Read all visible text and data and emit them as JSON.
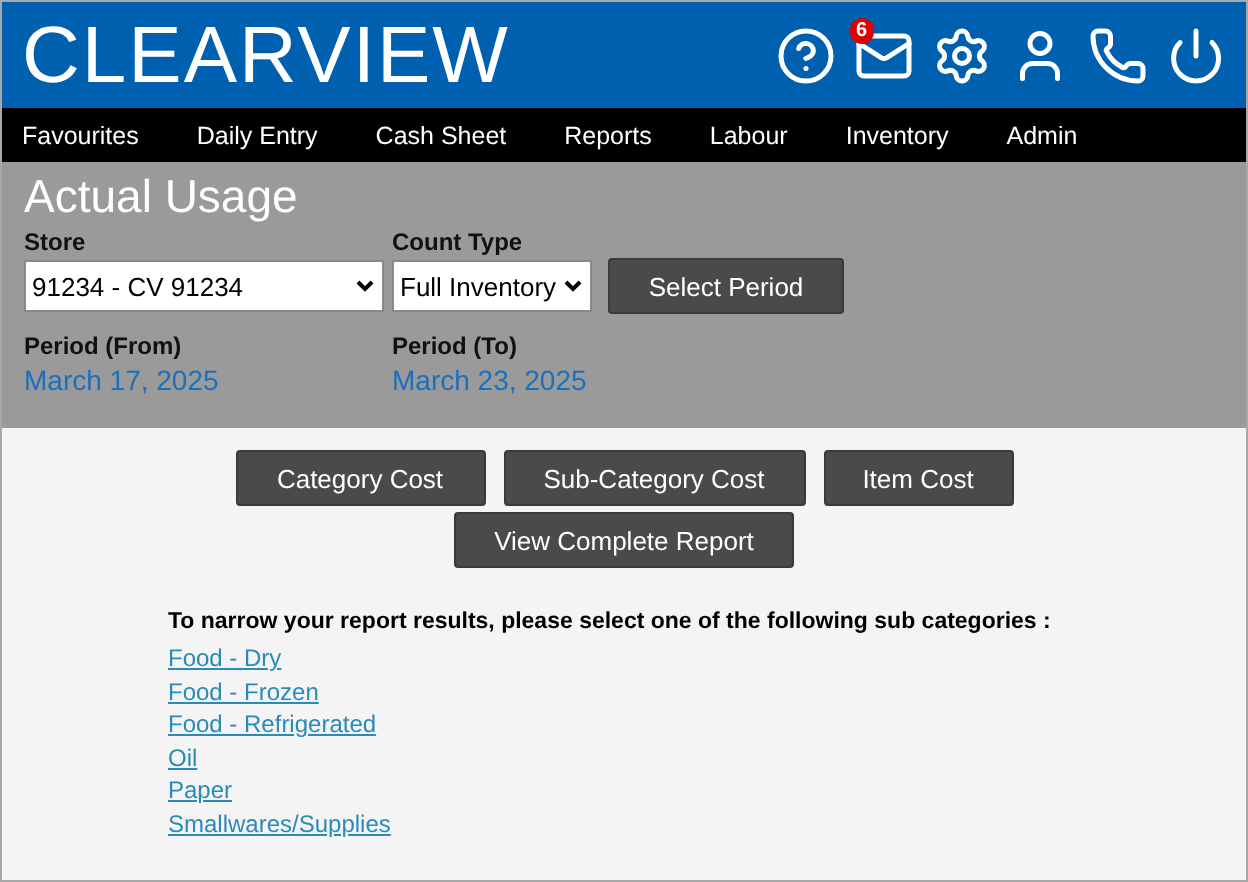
{
  "logo": "CLEARVIEW",
  "header_icons": [
    {
      "kind": "help"
    },
    {
      "kind": "mail",
      "badge": "6"
    },
    {
      "kind": "settings"
    },
    {
      "kind": "user"
    },
    {
      "kind": "phone"
    },
    {
      "kind": "power"
    }
  ],
  "nav": [
    "Favourites",
    "Daily Entry",
    "Cash Sheet",
    "Reports",
    "Labour",
    "Inventory",
    "Admin"
  ],
  "page_title": "Actual Usage",
  "store": {
    "label": "Store",
    "value": "91234 - CV 91234"
  },
  "count_type": {
    "label": "Count Type",
    "value": "Full Inventory"
  },
  "select_period_button": "Select Period",
  "period_from": {
    "label": "Period (From)",
    "value": "March 17, 2025"
  },
  "period_to": {
    "label": "Period (To)",
    "value": "March 23, 2025"
  },
  "report_buttons": [
    "Category Cost",
    "Sub-Category Cost",
    "Item Cost",
    "View Complete Report"
  ],
  "instructions": "To narrow your report results, please select one of the following sub categories :",
  "sub_categories": [
    "Food - Dry",
    "Food - Frozen",
    "Food - Refrigerated",
    "Oil",
    "Paper",
    "Smallwares/Supplies"
  ]
}
